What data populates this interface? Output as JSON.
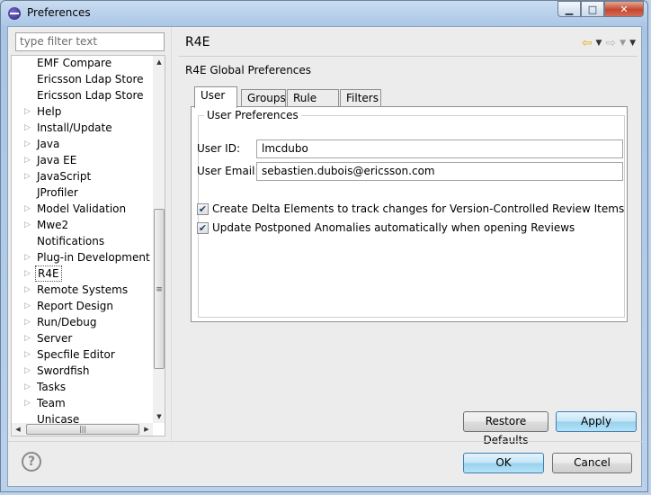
{
  "window": {
    "title": "Preferences"
  },
  "filter": {
    "placeholder": "type filter text"
  },
  "tree": [
    {
      "label": "EMF Compare",
      "arrow": false
    },
    {
      "label": "Ericsson Ldap Store",
      "arrow": false
    },
    {
      "label": "Ericsson Ldap Store",
      "arrow": false
    },
    {
      "label": "Help",
      "arrow": true
    },
    {
      "label": "Install/Update",
      "arrow": true
    },
    {
      "label": "Java",
      "arrow": true
    },
    {
      "label": "Java EE",
      "arrow": true
    },
    {
      "label": "JavaScript",
      "arrow": true
    },
    {
      "label": "JProfiler",
      "arrow": false
    },
    {
      "label": "Model Validation",
      "arrow": true
    },
    {
      "label": "Mwe2",
      "arrow": true
    },
    {
      "label": "Notifications",
      "arrow": false
    },
    {
      "label": "Plug-in Development",
      "arrow": true
    },
    {
      "label": "R4E",
      "arrow": true,
      "selected": true
    },
    {
      "label": "Remote Systems",
      "arrow": true
    },
    {
      "label": "Report Design",
      "arrow": true
    },
    {
      "label": "Run/Debug",
      "arrow": true
    },
    {
      "label": "Server",
      "arrow": true
    },
    {
      "label": "Specfile Editor",
      "arrow": true
    },
    {
      "label": "Swordfish",
      "arrow": true
    },
    {
      "label": "Tasks",
      "arrow": true
    },
    {
      "label": "Team",
      "arrow": true
    },
    {
      "label": "Unicase",
      "arrow": false
    }
  ],
  "page": {
    "title": "R4E",
    "description": "R4E Global Preferences",
    "tabs": [
      "User",
      "Groups",
      "Rule Sets",
      "Filters"
    ],
    "group_title": "User Preferences",
    "user_id_label": "User ID:",
    "user_id_value": "lmcdubo",
    "user_email_label": "User Email:",
    "user_email_value": "sebastien.dubois@ericsson.com",
    "checkbox1": "Create Delta Elements to track changes for Version-Controlled Review Items",
    "checkbox2": "Update Postponed Anomalies automatically when opening Reviews",
    "checkbox1_checked": true,
    "checkbox2_checked": true
  },
  "buttons": {
    "restore_defaults": "Restore Defaults",
    "apply": "Apply",
    "ok": "OK",
    "cancel": "Cancel"
  }
}
